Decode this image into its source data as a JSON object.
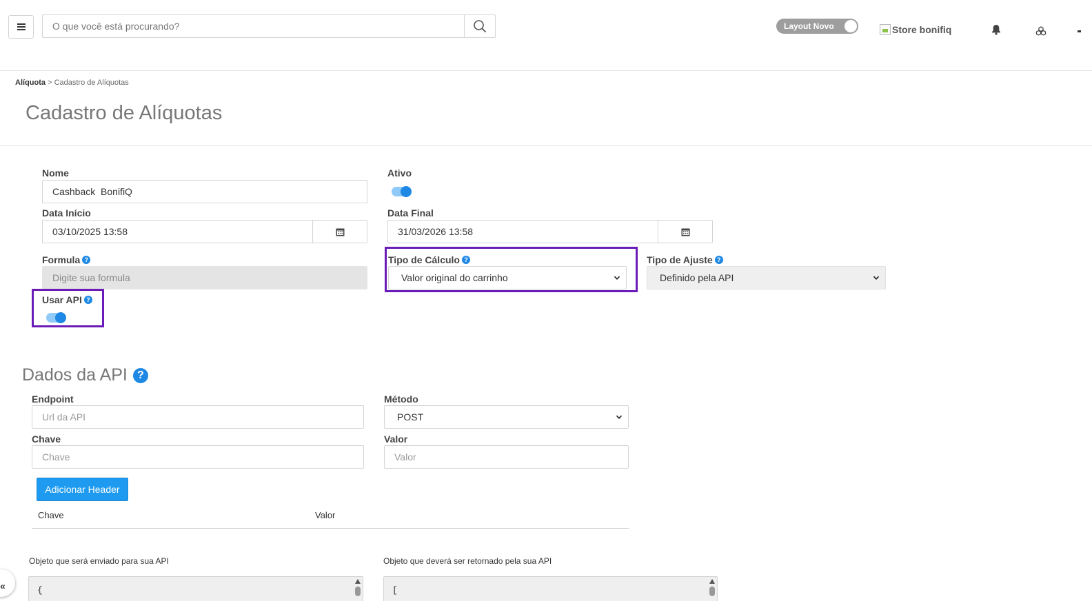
{
  "header": {
    "search_placeholder": "O que você está procurando?",
    "layout_toggle_label": "Layout Novo",
    "store_logo_alt": "Store bonifiq"
  },
  "breadcrumb": {
    "link": "Alíquota",
    "separator": ">",
    "current": "Cadastro de Alíquotas"
  },
  "page_title": "Cadastro de Alíquotas",
  "form": {
    "nome": {
      "label": "Nome",
      "value": "Cashback  BonifiQ"
    },
    "ativo": {
      "label": "Ativo",
      "checked": true
    },
    "data_inicio": {
      "label": "Data Início",
      "value": "03/10/2025 13:58"
    },
    "data_final": {
      "label": "Data Final",
      "value": "31/03/2026 13:58"
    },
    "formula": {
      "label": "Formula",
      "placeholder": "Digite sua formula"
    },
    "tipo_calculo": {
      "label": "Tipo de Cálculo",
      "selected": "Valor original do carrinho"
    },
    "tipo_ajuste": {
      "label": "Tipo de Ajuste",
      "selected": "Definido pela API"
    },
    "usar_api": {
      "label": "Usar API",
      "checked": true
    }
  },
  "api_section": {
    "title": "Dados da API",
    "endpoint": {
      "label": "Endpoint",
      "placeholder": "Url da API"
    },
    "metodo": {
      "label": "Método",
      "selected": "POST"
    },
    "chave": {
      "label": "Chave",
      "placeholder": "Chave"
    },
    "valor": {
      "label": "Valor",
      "placeholder": "Valor"
    },
    "add_header_button": "Adicionar Header",
    "headers_table": {
      "columns": [
        "Chave",
        "Valor"
      ]
    },
    "request_object": {
      "label": "Objeto que será enviado para sua API",
      "content": "{"
    },
    "response_object": {
      "label": "Objeto que deverá ser retornado pela sua API",
      "content": "["
    }
  },
  "sidebar_collapse_icon": "«",
  "colors": {
    "accent": "#1e88e5",
    "button": "#1e9bf0",
    "highlight": "#6a1bb8"
  }
}
